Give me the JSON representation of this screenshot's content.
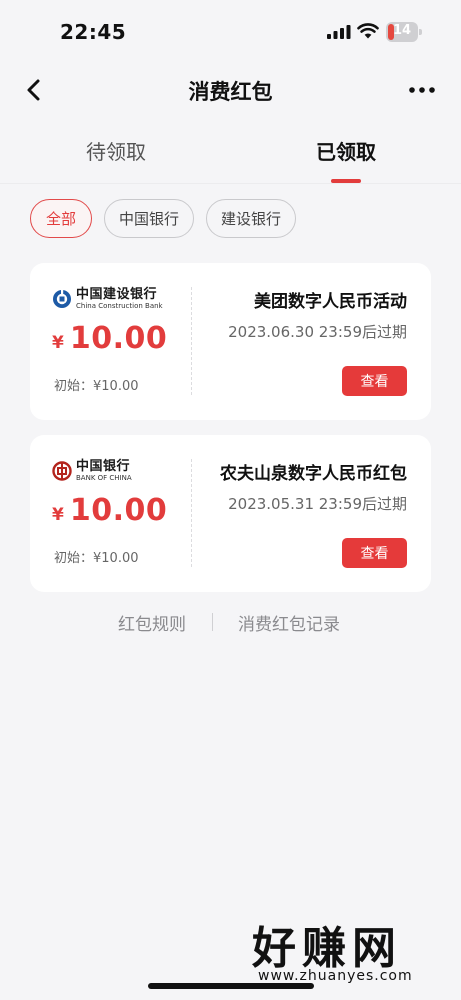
{
  "status_bar": {
    "time": "22:45",
    "battery_level": "14",
    "battery_fraction": 0.14,
    "icons": [
      "signal-icon",
      "wifi-icon",
      "battery-icon"
    ]
  },
  "nav": {
    "title": "消费红包",
    "back_icon": "back-chevron-icon",
    "more_icon": "more-dots-icon"
  },
  "tabs": [
    {
      "label": "待领取",
      "active": false
    },
    {
      "label": "已领取",
      "active": true
    }
  ],
  "filters": [
    {
      "label": "全部",
      "active": true
    },
    {
      "label": "中国银行",
      "active": false
    },
    {
      "label": "建设银行",
      "active": false
    }
  ],
  "cards": [
    {
      "bank_logo_cn": "中国建设银行",
      "bank_logo_en": "China Construction Bank",
      "currency_symbol": "¥",
      "amount": "10.00",
      "initial_label": "初始：¥10.00",
      "title": "美团数字人民币活动",
      "expiry": "2023.06.30 23:59后过期",
      "button": "查看"
    },
    {
      "bank_logo_cn": "中国银行",
      "bank_logo_en": "BANK OF CHINA",
      "currency_symbol": "¥",
      "amount": "10.00",
      "initial_label": "初始：¥10.00",
      "title": "农夫山泉数字人民币红包",
      "expiry": "2023.05.31 23:59后过期",
      "button": "查看"
    }
  ],
  "footer": {
    "rules": "红包规则",
    "records": "消费红包记录"
  },
  "watermark": {
    "title": "好赚网",
    "domain": "www.zhuanyes.com"
  },
  "colors": {
    "accent": "#e23c3c",
    "button": "#e53a3a",
    "background": "#f5f5f7",
    "ccb_blue": "#1d5aa6",
    "boc_red": "#b3241d"
  }
}
